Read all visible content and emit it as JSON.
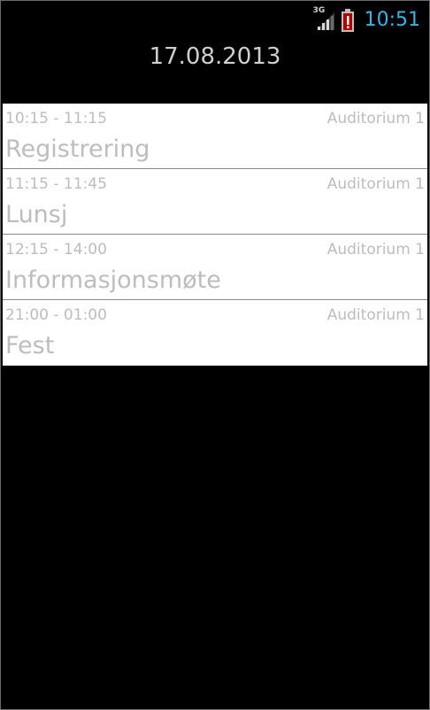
{
  "status_bar": {
    "network_type": "3G",
    "signal_icon": "signal-icon",
    "battery_icon": "battery-alert-icon",
    "clock": "10:51",
    "clock_color": "#33b5e5"
  },
  "header": {
    "date": "17.08.2013"
  },
  "events": [
    {
      "time": "10:15 - 11:15",
      "room": "Auditorium 1",
      "title": "Registrering"
    },
    {
      "time": "11:15 - 11:45",
      "room": "Auditorium 1",
      "title": "Lunsj"
    },
    {
      "time": "12:15 - 14:00",
      "room": "Auditorium 1",
      "title": "Informasjonsmøte"
    },
    {
      "time": "21:00 - 01:00",
      "room": "Auditorium 1",
      "title": "Fest"
    }
  ]
}
